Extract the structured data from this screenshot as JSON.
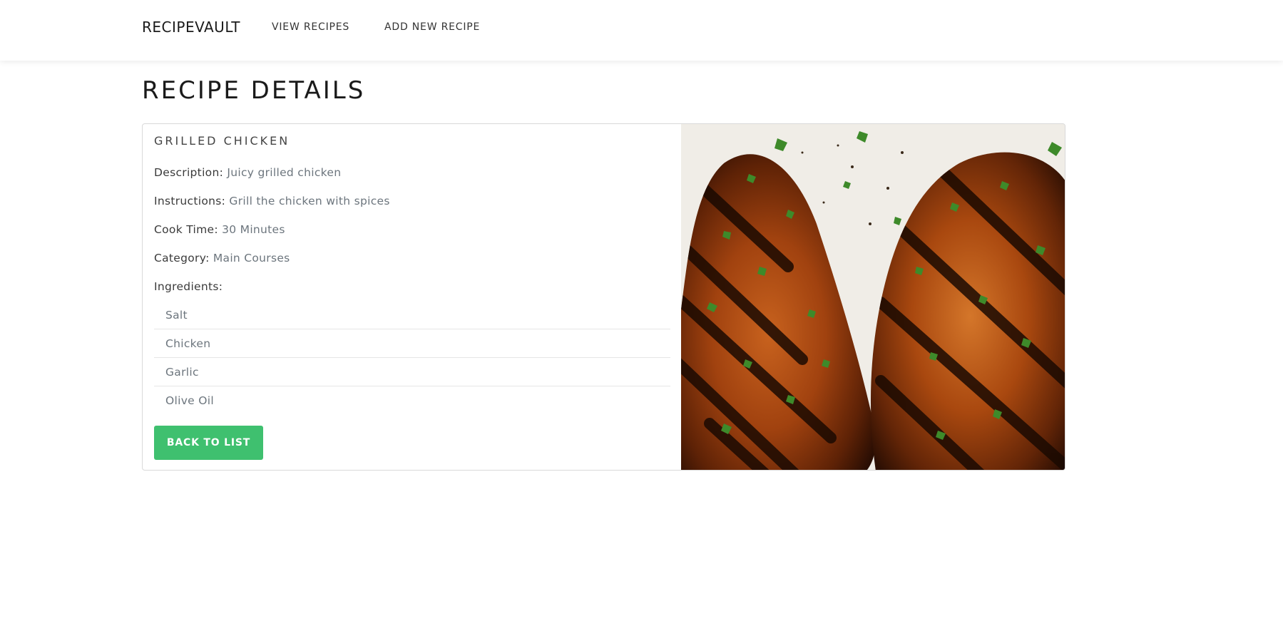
{
  "navbar": {
    "brand": "RECIPEVAULT",
    "links": [
      {
        "label": "VIEW RECIPES"
      },
      {
        "label": "ADD NEW RECIPE"
      }
    ]
  },
  "page": {
    "title": "RECIPE DETAILS"
  },
  "recipe": {
    "name": "GRILLED CHICKEN",
    "fields": {
      "description": {
        "label": "Description:",
        "value": "Juicy grilled chicken"
      },
      "instructions": {
        "label": "Instructions:",
        "value": "Grill the chicken with spices"
      },
      "cook_time": {
        "label": "Cook Time:",
        "value": "30 Minutes"
      },
      "category": {
        "label": "Category:",
        "value": "Main Courses"
      }
    },
    "ingredients_label": "Ingredients:",
    "ingredients": [
      "Salt",
      "Chicken",
      "Garlic",
      "Olive Oil"
    ],
    "image_alt": "Grilled chicken breasts with herbs"
  },
  "actions": {
    "back_label": "BACK TO LIST"
  },
  "colors": {
    "accent_button": "#3fc06f",
    "muted_text": "#6c757d",
    "card_border": "#d9d9d9"
  }
}
